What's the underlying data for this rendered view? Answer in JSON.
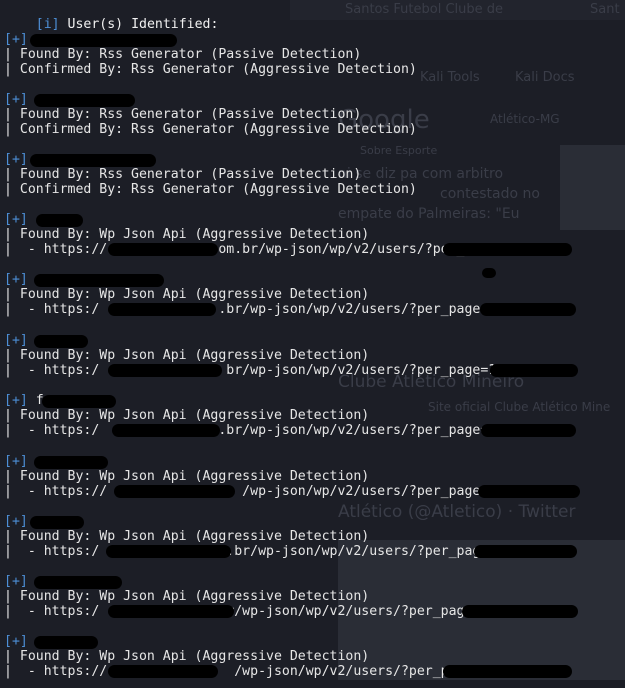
{
  "header": {
    "tag": "[i]",
    "text": "User(s) Identified:"
  },
  "colors": {
    "background": "#1c1e26",
    "text": "#e6e6e6",
    "tag_blue": "#4d8fd6",
    "redaction": "#000000"
  },
  "entries": [
    {
      "tag": "[+]",
      "line1": "| Found By: Rss Generator (Passive Detection)",
      "line2": "| Confirmed By: Rss Generator (Aggressive Detection)"
    },
    {
      "tag": "[+]",
      "line1": "| Found By: Rss Generator (Passive Detection)",
      "line2": "| Confirmed By: Rss Generator (Aggressive Detection)"
    },
    {
      "tag": "[+]",
      "line1": "| Found By: Rss Generator (Passive Detection)",
      "line2": "| Confirmed By: Rss Generator (Aggressive Detection)"
    },
    {
      "tag": "[+]",
      "line1": "| Found By: Wp Json Api (Aggressive Detection)",
      "line2": "|  - https://              om.br/wp-json/wp/v2/users/?per_"
    },
    {
      "tag": "[+]",
      "line1": "| Found By: Wp Json Api (Aggressive Detection)",
      "line2": "|  - https:/               .br/wp-json/wp/v2/users/?per_page=1"
    },
    {
      "tag": "[+]",
      "line1": "| Found By: Wp Json Api (Aggressive Detection)",
      "line2": "|  - https:/                br/wp-json/wp/v2/users/?per_page=1"
    },
    {
      "tag": "[+]",
      "prefix": "f",
      "line1": "| Found By: Wp Json Api (Aggressive Detection)",
      "line2": "|  - https:/               .br/wp-json/wp/v2/users/?per_page="
    },
    {
      "tag": "[+]",
      "line1": "| Found By: Wp Json Api (Aggressive Detection)",
      "line2": "|  - https://                 /wp-json/wp/v2/users/?per_page"
    },
    {
      "tag": "[+]",
      "line1": "| Found By: Wp Json Api (Aggressive Detection)",
      "line2": "|  - https:/               m.br/wp-json/wp/v2/users/?per_page="
    },
    {
      "tag": "[+]",
      "line1": "| Found By: Wp Json Api (Aggressive Detection)",
      "line2": "|  - https:/                r/wp-json/wp/v2/users/?per_page"
    },
    {
      "tag": "[+]",
      "line1": "| Found By: Wp Json Api (Aggressive Detection)",
      "line2": "|  - https://                /wp-json/wp/v2/users/?per_pag"
    }
  ],
  "background_ghost": {
    "tab1": "Santos Futebol Clube de",
    "tab2": "Sant",
    "bookmark1": "Kali Tools",
    "bookmark2": "Kali Docs",
    "search_text": "Atlético-MG",
    "google": "Google",
    "snippet1": "Sobre Esporte",
    "snippet2": "ni se diz pa com arbitro",
    "snippet3": "contestado no",
    "snippet4": "empate do Palmeiras: \"Eu",
    "site_title": "Clube Atlético Mineiro",
    "site_desc": "Site oficial Clube Atlético Mine",
    "twitter": "Atlético (@Atletico) · Twitter"
  }
}
